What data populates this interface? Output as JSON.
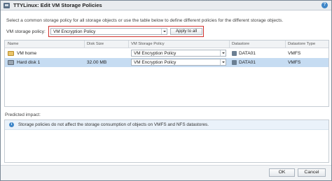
{
  "window": {
    "title": "TTYLinux: Edit VM Storage Policies",
    "help_icon": "?"
  },
  "intro": "Select a common storage policy for all storage objects or use the table below to define different policies for the different storage objects.",
  "policy": {
    "label": "VM storage policy:",
    "selected": "VM Encryption Policy",
    "apply_label": "Apply to all"
  },
  "table": {
    "headers": [
      "Name",
      "Disk Size",
      "VM Storage Policy",
      "Datastore",
      "Datastore Type"
    ],
    "rows": [
      {
        "name": "VM home",
        "icon": "folder-icon",
        "disk_size": "",
        "policy": "VM Encryption Policy",
        "datastore": "DATA01",
        "datastore_type": "VMFS",
        "selected": false
      },
      {
        "name": "Hard disk 1",
        "icon": "disk-icon",
        "disk_size": "32.00 MB",
        "policy": "VM Encryption Policy",
        "datastore": "DATA01",
        "datastore_type": "VMFS",
        "selected": true
      }
    ]
  },
  "impact": {
    "label": "Predicted impact:",
    "info_icon": "i",
    "message": "Storage policies do not affect the storage consumption of objects on VMFS and NFS datastores."
  },
  "footer": {
    "ok_label": "OK",
    "cancel_label": "Cancel"
  }
}
